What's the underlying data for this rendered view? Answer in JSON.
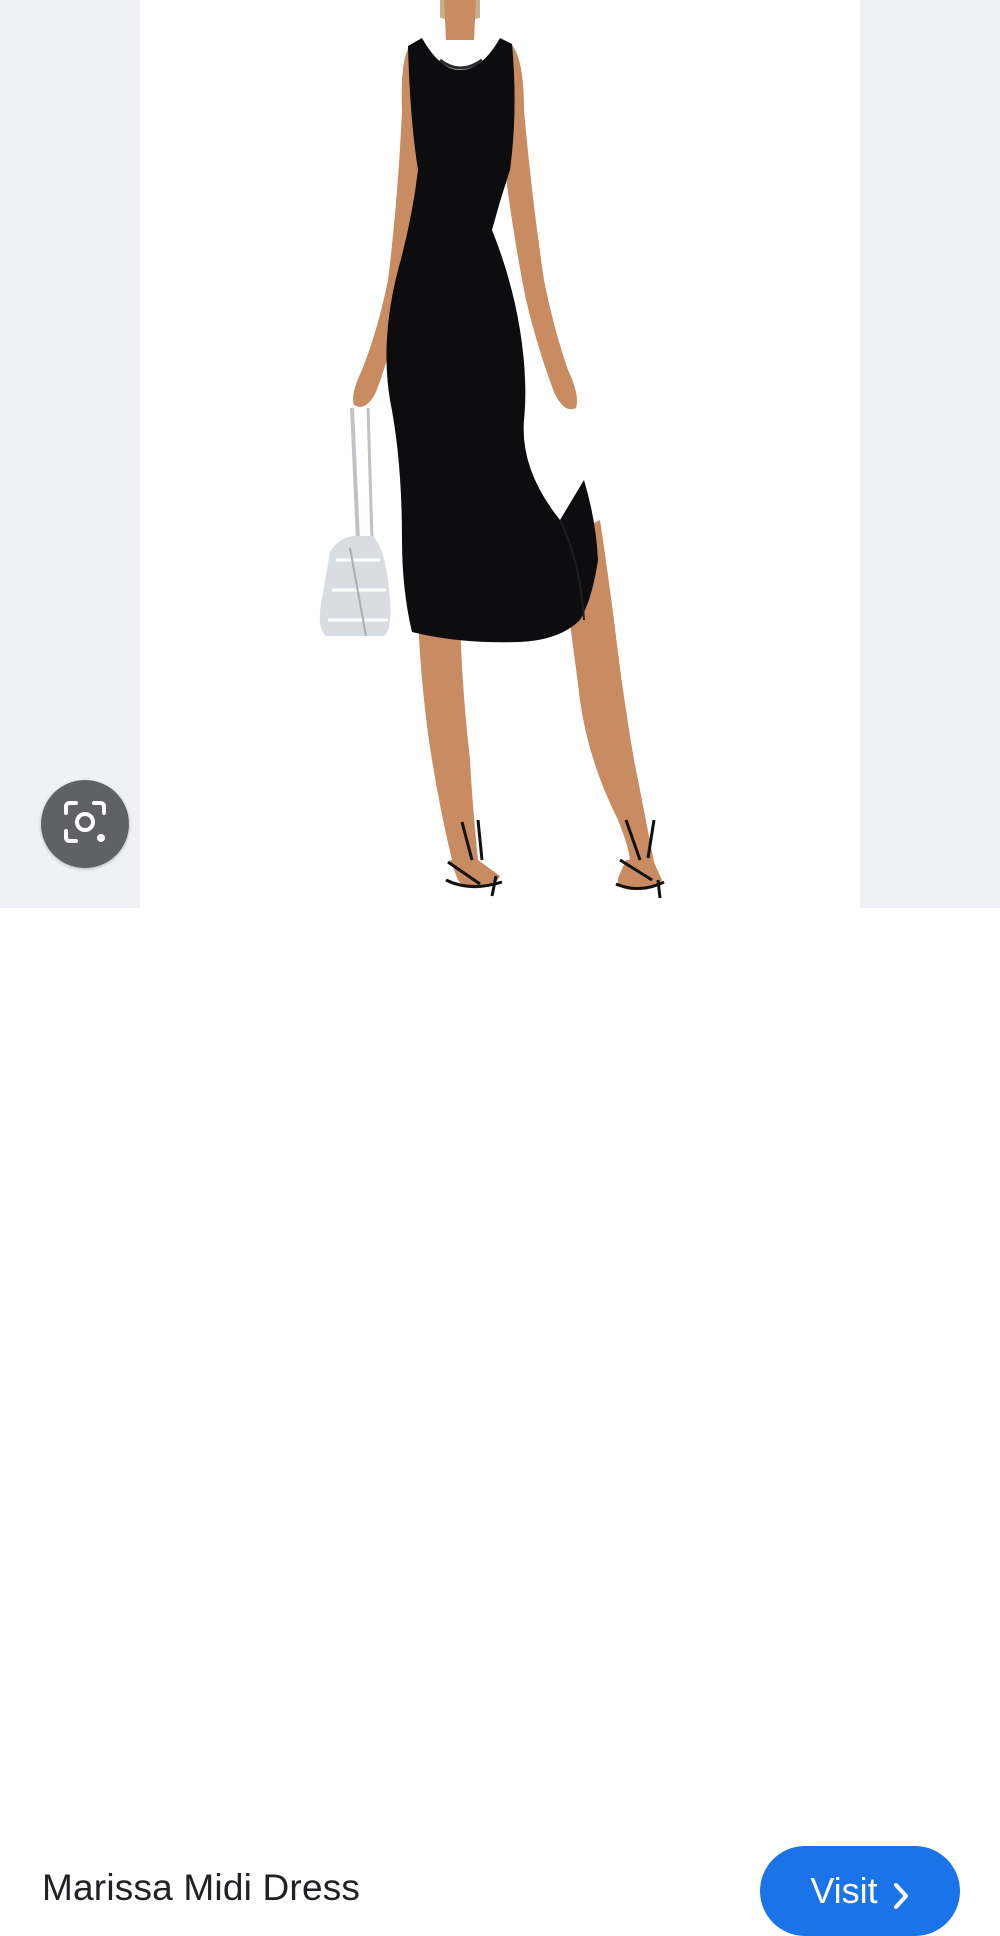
{
  "product": {
    "title": "Marissa Midi Dress"
  },
  "actions": {
    "visit_label": "Visit",
    "visit_icon": "chevron-right-icon",
    "lens_icon": "camera-lens-icon"
  },
  "colors": {
    "accent": "#1a73e8",
    "lens_button_bg": "#5f6164",
    "panel_bg": "#eff1f5",
    "title_text": "#202124"
  }
}
